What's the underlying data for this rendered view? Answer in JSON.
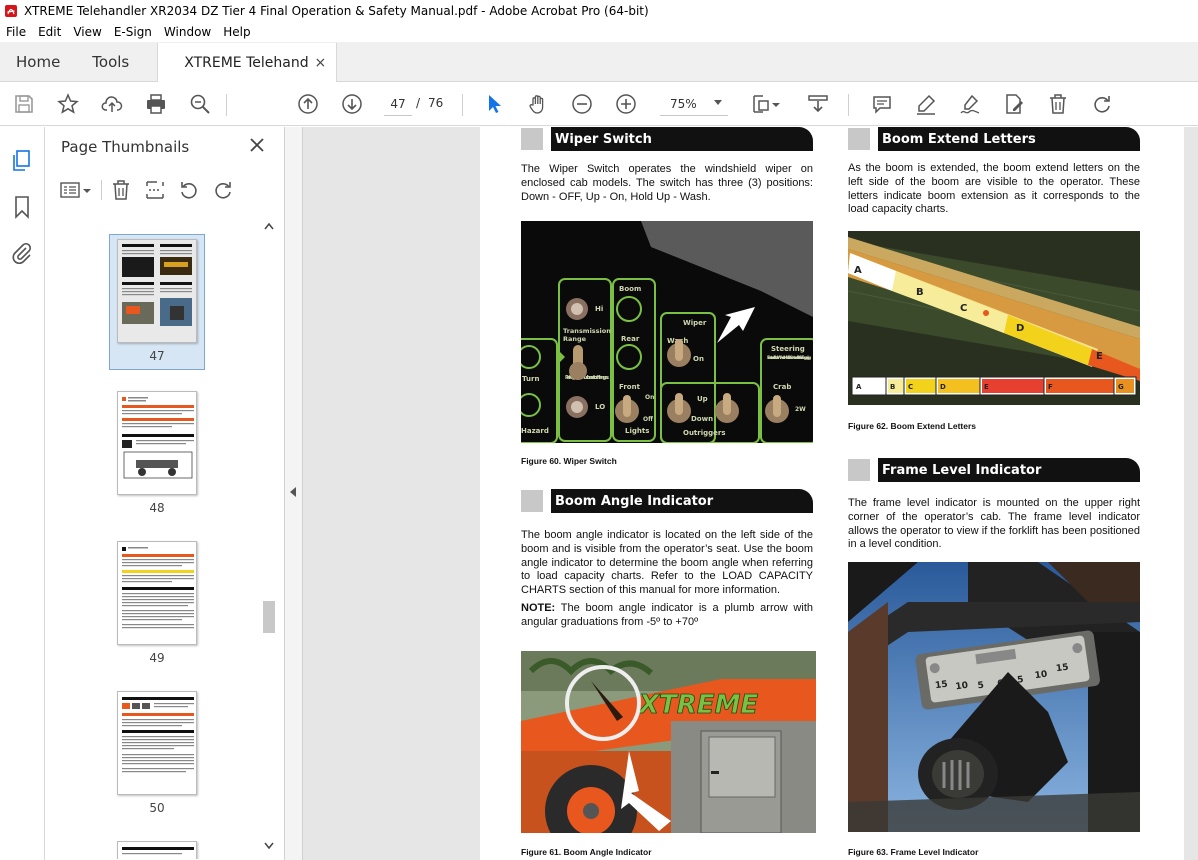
{
  "window": {
    "title": "XTREME Telehandler XR2034 DZ Tier 4 Final Operation & Safety Manual.pdf - Adobe Acrobat Pro (64-bit)"
  },
  "menu": [
    "File",
    "Edit",
    "View",
    "E-Sign",
    "Window",
    "Help"
  ],
  "tabs": {
    "home": "Home",
    "tools": "Tools",
    "document": "XTREME Telehandle...",
    "close": "×"
  },
  "toolbar": {
    "current_page": "47",
    "page_separator": "/",
    "total_pages": "76",
    "zoom": "75%"
  },
  "thumbnails": {
    "title": "Page Thumbnails",
    "pages": [
      {
        "label": "47",
        "selected": true
      },
      {
        "label": "48",
        "selected": false
      },
      {
        "label": "49",
        "selected": false
      },
      {
        "label": "50",
        "selected": false
      }
    ]
  },
  "document": {
    "wiper_switch": {
      "heading": "Wiper Switch",
      "body": "The Wiper Switch operates the windshield wiper on enclosed cab models.  The switch has three (3) positions: Down - OFF, Up - On, Hold Up - Wash.",
      "figure_caption": "Figure 60.  Wiper Switch",
      "panel_labels": {
        "hi": "Hi",
        "lo": "LO",
        "transmission": "Transmission",
        "range": "Range",
        "parking_note": "Parking brake must be set to shift ranges.",
        "boom": "Boom",
        "rear": "Rear",
        "front": "Front",
        "wiper": "Wiper",
        "wash": "Wash",
        "on": "On",
        "off": "Off",
        "lights": "Lights",
        "up": "Up",
        "down": "Down",
        "outriggers": "Outriggers",
        "steering": "Steering",
        "steering_note": "Front and Rear Wheels Must Be Centered Before Engaging.",
        "crab": "Crab",
        "turn": "Turn",
        "hazard": "Hazard",
        "two_w": "2W"
      }
    },
    "boom_angle": {
      "heading": "Boom Angle Indicator",
      "body": "The boom angle indicator is located on the left side of the boom and is visible from the operator’s seat.  Use the boom angle indicator to determine the boom angle when referring to load capacity charts.  Refer to the LOAD CAPACITY CHARTS section of this manual for more information.",
      "note_label": "NOTE:",
      "note_body": " The boom angle indicator is a plumb arrow with angular graduations from -5º to +70º",
      "figure_caption": "Figure 61.  Boom Angle Indicator",
      "brand_text": "XTREME"
    },
    "boom_extend": {
      "heading": "Boom Extend Letters",
      "body": "As the boom is extended, the boom extend letters on the left side of the boom are visible to the operator.  These letters indicate boom extension as it corresponds to the load capacity charts.",
      "figure_caption": "Figure 62.  Boom Extend Letters",
      "letters": [
        "A",
        "B",
        "C",
        "D",
        "E",
        "F",
        "G"
      ]
    },
    "frame_level": {
      "heading": "Frame Level Indicator",
      "body": "The frame level indicator is mounted on the upper right corner of the operator’s cab.  The frame level indicator allows the operator to view if the forklift has been positioned in a level condition.",
      "figure_caption": "Figure 63.  Frame Level Indicator",
      "scale": [
        "15",
        "10",
        "5",
        "0",
        "5",
        "10",
        "15"
      ]
    }
  },
  "colors": {
    "accent_blue": "#1473e6",
    "panel_green": "#7bc043",
    "boom_orange": "#e8571e"
  }
}
